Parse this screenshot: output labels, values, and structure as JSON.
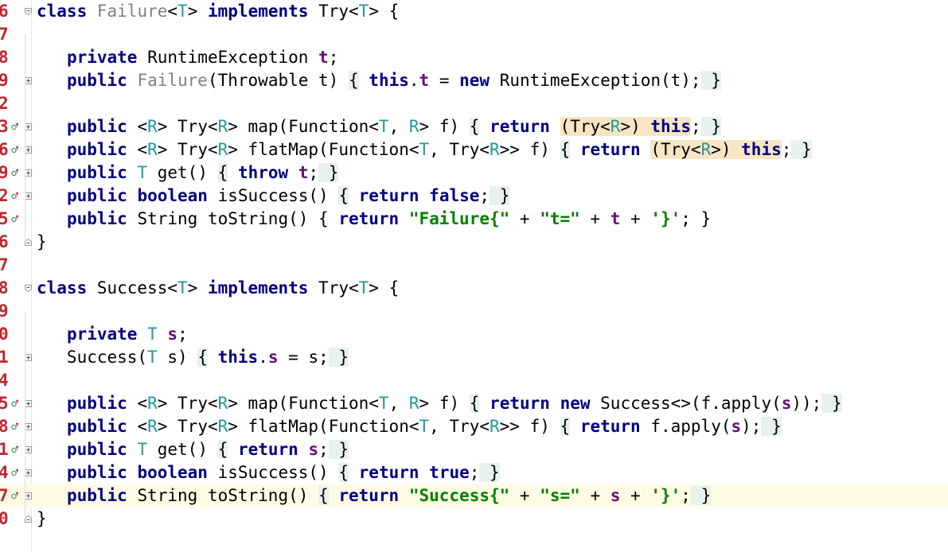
{
  "editor": {
    "line_numbers": [
      "6",
      "7",
      "8",
      "9",
      "2",
      "3",
      "6",
      "9",
      "2",
      "5",
      "6",
      "7",
      "8",
      "9",
      "0",
      "1",
      "4",
      "5",
      "8",
      "1",
      "4",
      "7",
      "0"
    ],
    "colors": {
      "keyword": "#000080",
      "type_param": "#20999d",
      "field": "#660e7a",
      "string": "#008000",
      "gray_name": "#808080",
      "line_number": "#c0272d",
      "fold_highlight": "#e8f2ec",
      "cast_highlight": "#f8e5c4",
      "current_line": "#fffae3"
    },
    "gutter_icons": {
      "override": "override-implements-icon",
      "fold": "fold-toggle-icon"
    }
  }
}
